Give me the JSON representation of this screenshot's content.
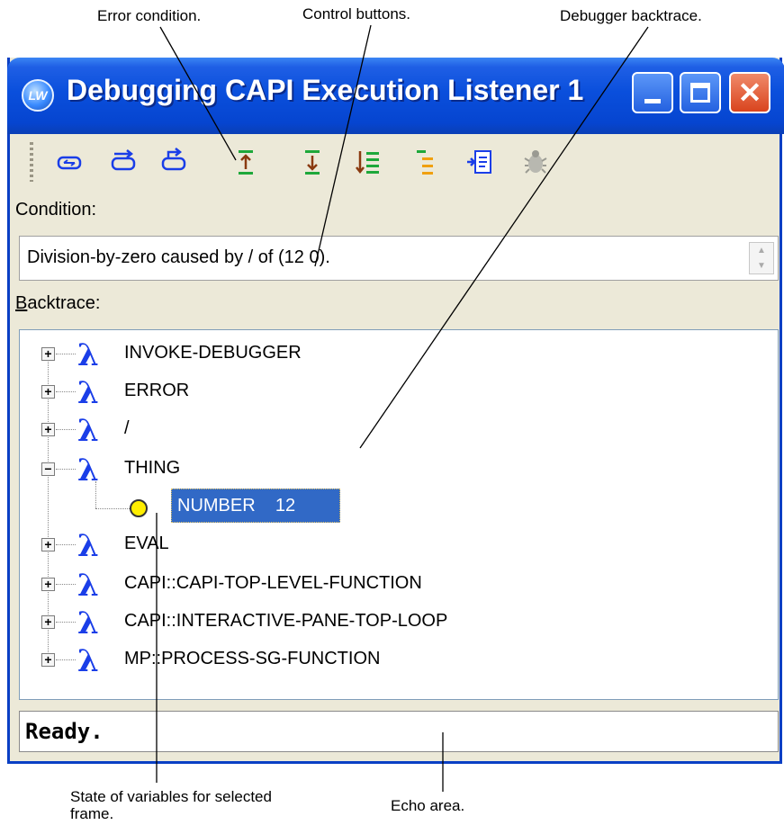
{
  "callouts": {
    "error_condition": "Error condition.",
    "control_buttons": "Control buttons.",
    "debugger_backtrace": "Debugger backtrace.",
    "state_of_variables": "State of variables for selected frame.",
    "echo_area": "Echo area."
  },
  "window": {
    "title": "Debugging CAPI Execution Listener 1",
    "icon_text": "LW",
    "minimize_glyph": "",
    "close_glyph": "✕"
  },
  "toolbar": {
    "icons": [
      "abort-icon",
      "continue-icon",
      "restart-icon",
      "up-frame-icon",
      "down-frame-icon",
      "bottom-frame-icon",
      "top-frame-icon",
      "find-source-icon",
      "bug-icon"
    ]
  },
  "condition": {
    "label": "Condition:",
    "text": "Division-by-zero caused by / of (12 0)."
  },
  "backtrace": {
    "label_first": "B",
    "label_rest": "acktrace:",
    "frames": [
      {
        "name": "INVOKE-DEBUGGER",
        "expander": "+"
      },
      {
        "name": "ERROR",
        "expander": "+"
      },
      {
        "name": "/",
        "expander": "+"
      },
      {
        "name": "THING",
        "expander": "−"
      },
      {
        "name": "EVAL",
        "expander": "+"
      },
      {
        "name": "CAPI::CAPI-TOP-LEVEL-FUNCTION",
        "expander": "+"
      },
      {
        "name": "CAPI::INTERACTIVE-PANE-TOP-LOOP",
        "expander": "+"
      },
      {
        "name": "MP::PROCESS-SG-FUNCTION",
        "expander": "+"
      }
    ],
    "selected_variable": "NUMBER    12",
    "lambda_glyph": "λ"
  },
  "echo": {
    "status": "Ready."
  },
  "colors": {
    "titlebar": "#0a4fdc",
    "window_bg": "#ece9d8",
    "selection": "#3169c6",
    "lambda": "#1a3ee8"
  }
}
